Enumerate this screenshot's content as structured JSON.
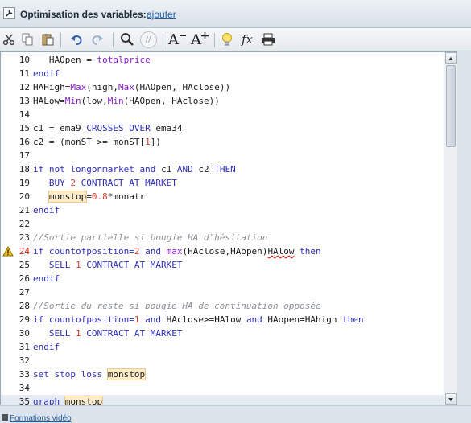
{
  "header": {
    "title": "Optimisation des variables:",
    "add_link": "ajouter"
  },
  "toolbar": {
    "icons": [
      "scissors-icon",
      "copy-icon",
      "paste-icon",
      "undo-icon",
      "redo-icon",
      "search-icon",
      "comment-icon",
      "decrease-font-icon",
      "increase-font-icon",
      "lightbulb-icon",
      "function-icon",
      "print-icon"
    ],
    "decrease_font_label": "A",
    "increase_font_label": "A",
    "function_label": "fx",
    "comment_label": "//"
  },
  "editor": {
    "lines": [
      {
        "n": "10",
        "tokens": [
          {
            "t": "   HAOpen = "
          },
          {
            "t": "totalprice",
            "c": "fn"
          }
        ]
      },
      {
        "n": "11",
        "tokens": [
          {
            "t": "endif",
            "c": "kw"
          }
        ]
      },
      {
        "n": "12",
        "tokens": [
          {
            "t": "HAHigh="
          },
          {
            "t": "Max",
            "c": "fn"
          },
          {
            "t": "(high,"
          },
          {
            "t": "Max",
            "c": "fn"
          },
          {
            "t": "(HAOpen, HAclose))"
          }
        ]
      },
      {
        "n": "13",
        "tokens": [
          {
            "t": "HALow="
          },
          {
            "t": "Min",
            "c": "fn"
          },
          {
            "t": "(low,"
          },
          {
            "t": "Min",
            "c": "fn"
          },
          {
            "t": "(HAOpen, HAclose))"
          }
        ]
      },
      {
        "n": "14",
        "tokens": []
      },
      {
        "n": "15",
        "tokens": [
          {
            "t": "c1 = ema9 "
          },
          {
            "t": "CROSSES OVER",
            "c": "kw"
          },
          {
            "t": " ema34"
          }
        ]
      },
      {
        "n": "16",
        "tokens": [
          {
            "t": "c2 = (monST >= monST["
          },
          {
            "t": "1",
            "c": "num"
          },
          {
            "t": "])"
          }
        ]
      },
      {
        "n": "17",
        "tokens": []
      },
      {
        "n": "18",
        "tokens": [
          {
            "t": "if not longonmarket and",
            "c": "kw"
          },
          {
            "t": " c1 "
          },
          {
            "t": "AND",
            "c": "kw"
          },
          {
            "t": " c2 "
          },
          {
            "t": "THEN",
            "c": "kw"
          }
        ]
      },
      {
        "n": "19",
        "tokens": [
          {
            "t": "   BUY ",
            "c": "kw"
          },
          {
            "t": "2",
            "c": "num"
          },
          {
            "t": " CONTRACT AT MARKET",
            "c": "kw"
          }
        ]
      },
      {
        "n": "20",
        "tokens": [
          {
            "t": "   "
          },
          {
            "t": "monstop",
            "c": "hl"
          },
          {
            "t": "="
          },
          {
            "t": "0.8",
            "c": "num"
          },
          {
            "t": "*monatr"
          }
        ]
      },
      {
        "n": "21",
        "tokens": [
          {
            "t": "endif",
            "c": "kw"
          }
        ]
      },
      {
        "n": "22",
        "tokens": []
      },
      {
        "n": "23",
        "tokens": [
          {
            "t": "//Sortie partielle si bougie HA d'hésitation",
            "c": "cm"
          }
        ]
      },
      {
        "n": "24",
        "err": true,
        "tokens": [
          {
            "t": "if countofposition=",
            "c": "kw"
          },
          {
            "t": "2",
            "c": "num"
          },
          {
            "t": " and ",
            "c": "kw"
          },
          {
            "t": "max",
            "c": "fn"
          },
          {
            "t": "(HAclose,HAopen)"
          },
          {
            "t": "HAlow",
            "c": "sq"
          },
          {
            "t": " then",
            "c": "kw"
          }
        ]
      },
      {
        "n": "25",
        "tokens": [
          {
            "t": "   SELL ",
            "c": "kw"
          },
          {
            "t": "1",
            "c": "num"
          },
          {
            "t": " CONTRACT AT MARKET",
            "c": "kw"
          }
        ]
      },
      {
        "n": "26",
        "tokens": [
          {
            "t": "endif",
            "c": "kw"
          }
        ]
      },
      {
        "n": "27",
        "tokens": []
      },
      {
        "n": "28",
        "tokens": [
          {
            "t": "//Sortie du reste si bougie HA de continuation opposée",
            "c": "cm"
          }
        ]
      },
      {
        "n": "29",
        "tokens": [
          {
            "t": "if countofposition=",
            "c": "kw"
          },
          {
            "t": "1",
            "c": "num"
          },
          {
            "t": " and ",
            "c": "kw"
          },
          {
            "t": "HAclose>=HAlow "
          },
          {
            "t": "and",
            "c": "kw"
          },
          {
            "t": " HAopen=HAhigh "
          },
          {
            "t": "then",
            "c": "kw"
          }
        ]
      },
      {
        "n": "30",
        "tokens": [
          {
            "t": "   SELL ",
            "c": "kw"
          },
          {
            "t": "1",
            "c": "num"
          },
          {
            "t": " CONTRACT AT MARKET",
            "c": "kw"
          }
        ]
      },
      {
        "n": "31",
        "tokens": [
          {
            "t": "endif",
            "c": "kw"
          }
        ]
      },
      {
        "n": "32",
        "tokens": []
      },
      {
        "n": "33",
        "tokens": [
          {
            "t": "set stop loss ",
            "c": "kw"
          },
          {
            "t": "monstop",
            "c": "hl"
          }
        ]
      },
      {
        "n": "34",
        "tokens": []
      },
      {
        "n": "35",
        "current": true,
        "tokens": [
          {
            "t": "graph ",
            "c": "kw"
          },
          {
            "t": "monstop",
            "c": "hl"
          }
        ]
      }
    ]
  },
  "footer": {
    "link": "Formations vidéo"
  }
}
